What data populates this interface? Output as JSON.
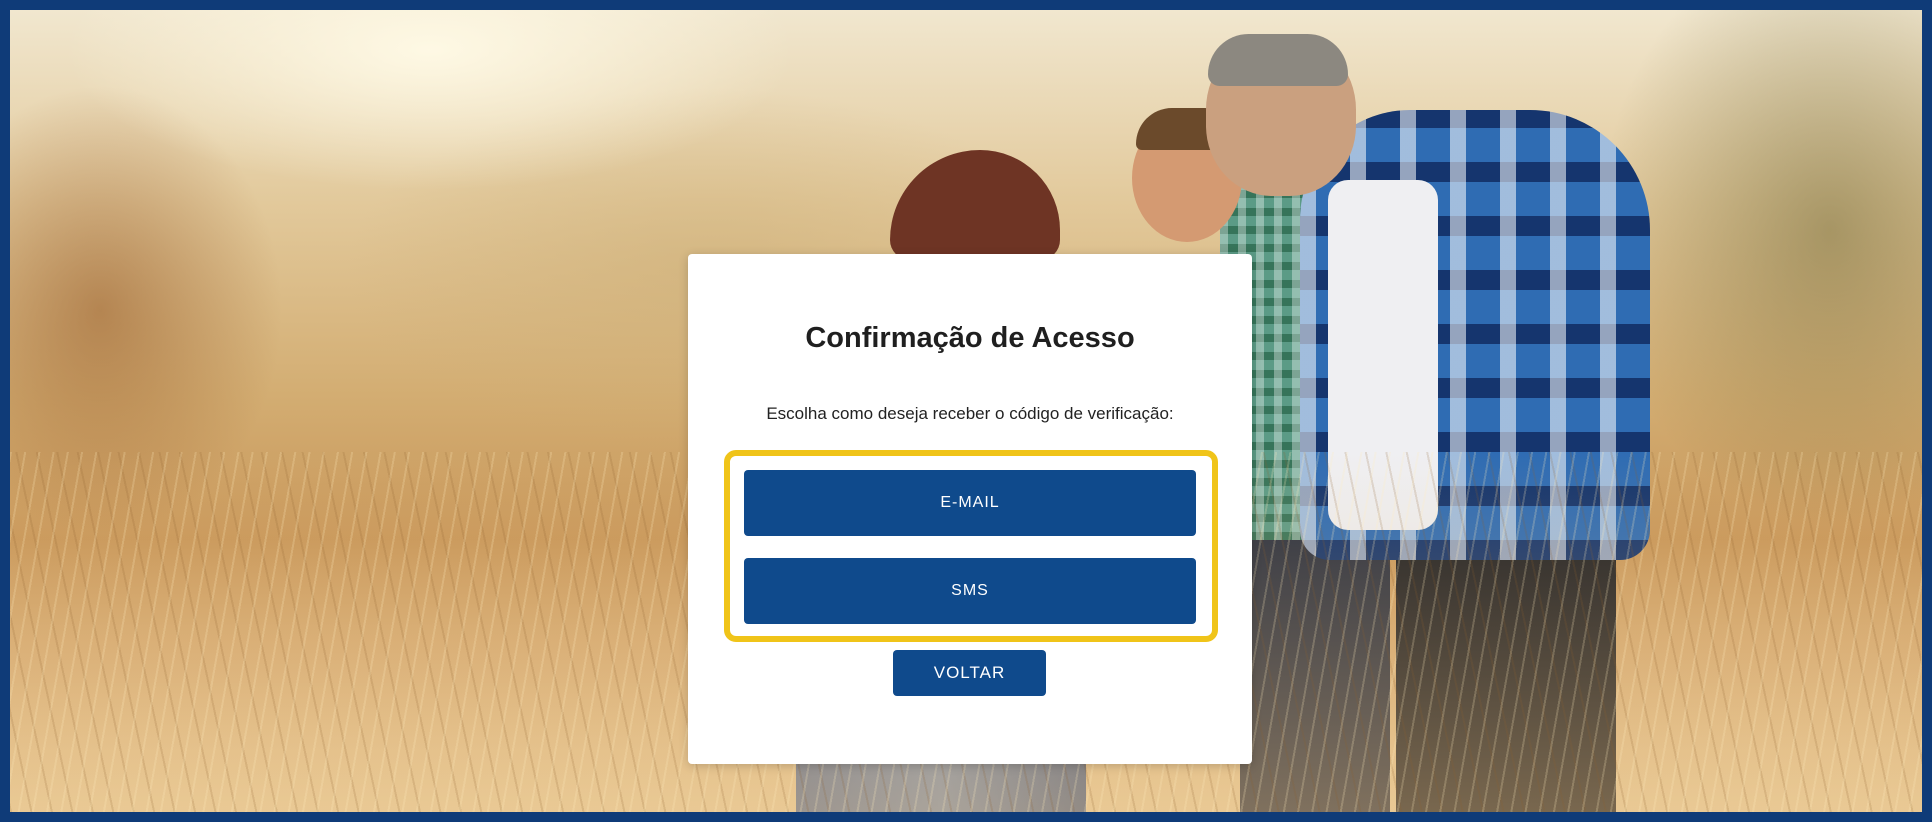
{
  "card": {
    "title": "Confirmação de Acesso",
    "subtitle": "Escolha como deseja receber o código de verificação:"
  },
  "options": {
    "email_label": "E-MAIL",
    "sms_label": "SMS"
  },
  "actions": {
    "back_label": "VOLTAR"
  },
  "colors": {
    "frame_border": "#0f3b78",
    "button_primary": "#0f4a8c",
    "highlight": "#f0c419",
    "card_background": "#ffffff"
  }
}
